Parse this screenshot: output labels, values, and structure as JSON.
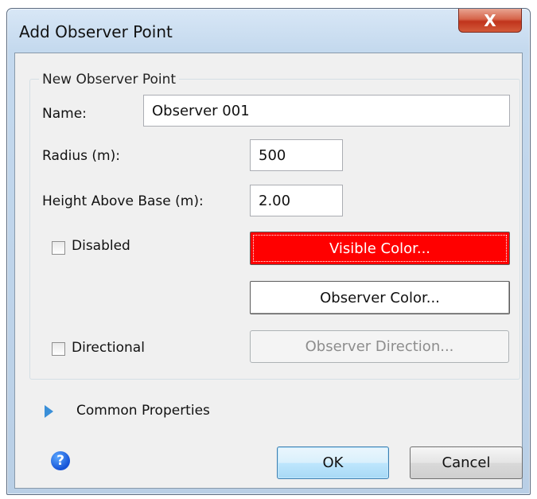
{
  "window": {
    "title": "Add Observer Point",
    "close_glyph": "X"
  },
  "group": {
    "title": "New Observer Point"
  },
  "fields": {
    "name_label": "Name:",
    "name_value": "Observer 001",
    "radius_label": "Radius (m):",
    "radius_value": "500",
    "height_label": "Height Above Base (m):",
    "height_value": "2.00"
  },
  "checks": {
    "disabled_label": "Disabled",
    "disabled_checked": false,
    "directional_label": "Directional",
    "directional_checked": false
  },
  "buttons": {
    "visible_color": "Visible Color...",
    "visible_color_value": "#ff0000",
    "observer_color": "Observer Color...",
    "observer_direction": "Observer Direction...",
    "ok": "OK",
    "cancel": "Cancel"
  },
  "common": {
    "label": "Common Properties",
    "expander_icon": "triangle-right-icon"
  },
  "help": {
    "glyph": "?"
  }
}
